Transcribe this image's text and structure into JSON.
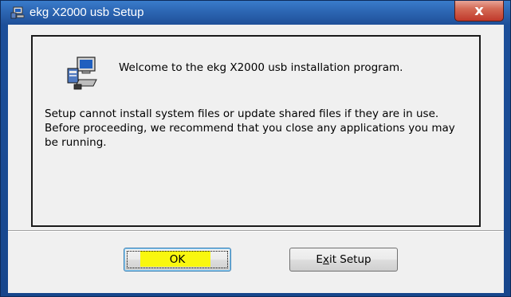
{
  "window": {
    "title": "ekg X2000 usb Setup",
    "close_glyph": "x",
    "title_icon": "setup-computer-icon"
  },
  "panel": {
    "icon": "setup-computer-icon",
    "welcome": "Welcome to the ekg X2000 usb installation program.",
    "body": "Setup cannot install system files or update shared files if they are in use. Before proceeding, we recommend that you close any applications you may be running."
  },
  "buttons": {
    "ok_label": "OK",
    "exit_prefix": "E",
    "exit_accel": "x",
    "exit_suffix": "it Setup"
  },
  "colors": {
    "title_bar": "#2c66b3",
    "close_button": "#c0392b",
    "ok_highlight": "#f9f70f",
    "dialog_bg": "#f0f0f0"
  }
}
